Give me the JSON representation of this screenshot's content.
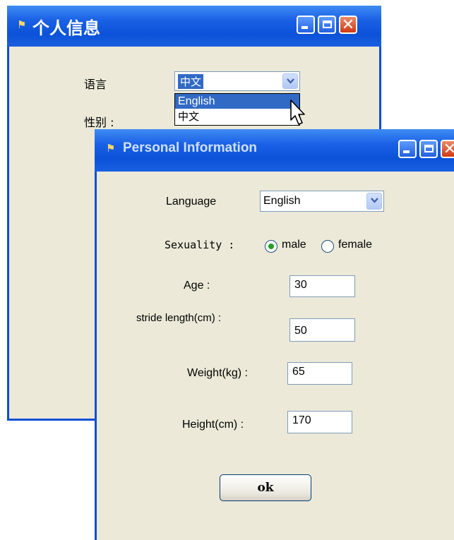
{
  "back_window": {
    "title_icon": "flag-icon",
    "title": "个人信息",
    "language_label": "语言",
    "language_value": "中文",
    "gender_label": "性别 :",
    "dropdown_options": [
      "English",
      "中文"
    ]
  },
  "front_window": {
    "title_icon": "flag-icon",
    "title": "Personal Information",
    "language_label": "Language",
    "language_value": "English",
    "sexuality_label": "Sexuality :",
    "male_label": "male",
    "female_label": "female",
    "selected_sex": "male",
    "age_label": "Age :",
    "age_value": "30",
    "stride_label": "stride length(cm) :",
    "stride_value": "50",
    "weight_label": "Weight(kg) :",
    "weight_value": "65",
    "height_label": "Height(cm) :",
    "height_value": "170",
    "ok_label": "ok"
  },
  "colors": {
    "titlebar": "#0b52d8",
    "window_bg": "#ece9d8",
    "selection": "#316ac5",
    "radio_dot": "#21a121"
  }
}
